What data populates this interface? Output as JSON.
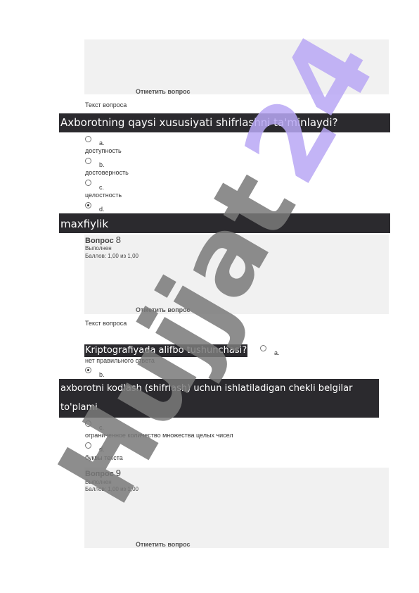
{
  "q7": {
    "flag_label": "Отметить вопрос",
    "text_label": "Текст вопроса",
    "question": "Axborotning qaysi xususiyati shifrlashni ta'minlaydi?",
    "options": [
      {
        "letter": "a.",
        "text": "доступность"
      },
      {
        "letter": "b.",
        "text": "достоверность"
      },
      {
        "letter": "c.",
        "text": "целостность"
      },
      {
        "letter": "d.",
        "text": "maxfiylik"
      }
    ]
  },
  "q8": {
    "title": "Вопрос",
    "number": "8",
    "status": "Выполнен",
    "score": "Баллов: 1,00 из 1,00",
    "flag_label": "Отметить вопрос",
    "text_label": "Текст вопроса",
    "question": "Kriptografiyada alifbo tushunchasi?",
    "options": [
      {
        "letter": "a.",
        "text": "нет правильного ответа"
      },
      {
        "letter": "b.",
        "text": "axborotni kodlash (shifrlash) uchun ishlatiladigan chekli belgilar to'plami"
      },
      {
        "letter": "c.",
        "text": "ограниченное количество множества целых чисел"
      },
      {
        "letter": "d.",
        "text": "буквы текста"
      }
    ]
  },
  "q9": {
    "title": "Вопрос",
    "number": "9",
    "status": "Выполнен",
    "score": "Баллов: 1,00 из 1,00",
    "flag_label": "Отметить вопрос"
  },
  "watermark": {
    "text": "Hujjat 24",
    "colors": {
      "hujjat": "#7a7a7a",
      "num": "#b9a8f5"
    }
  }
}
